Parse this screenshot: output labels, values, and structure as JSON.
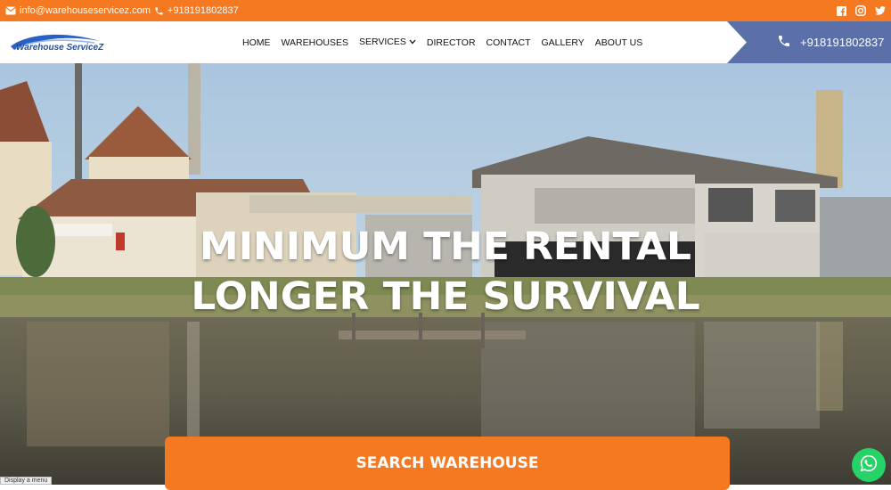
{
  "topbar": {
    "email": "info@warehouseservicez.com",
    "phone": "+918191802837",
    "social": [
      "facebook-icon",
      "instagram-icon",
      "twitter-icon"
    ],
    "bg_color": "#f47920"
  },
  "logo": {
    "text": "Warehouse ServiceZ"
  },
  "nav": {
    "items": [
      "HOME",
      "WAREHOUSES",
      "SERVICES",
      "DIRECTOR",
      "CONTACT",
      "GALLERY",
      "ABOUT US"
    ]
  },
  "phone_box": {
    "phone": "+918191802837",
    "bg_color": "#5b6fa8"
  },
  "hero": {
    "line1": "MINIMUM THE RENTAL",
    "line2": "LONGER THE SURVIVAL",
    "button": "SEARCH WAREHOUSE"
  },
  "tooltip": "Display a menu"
}
